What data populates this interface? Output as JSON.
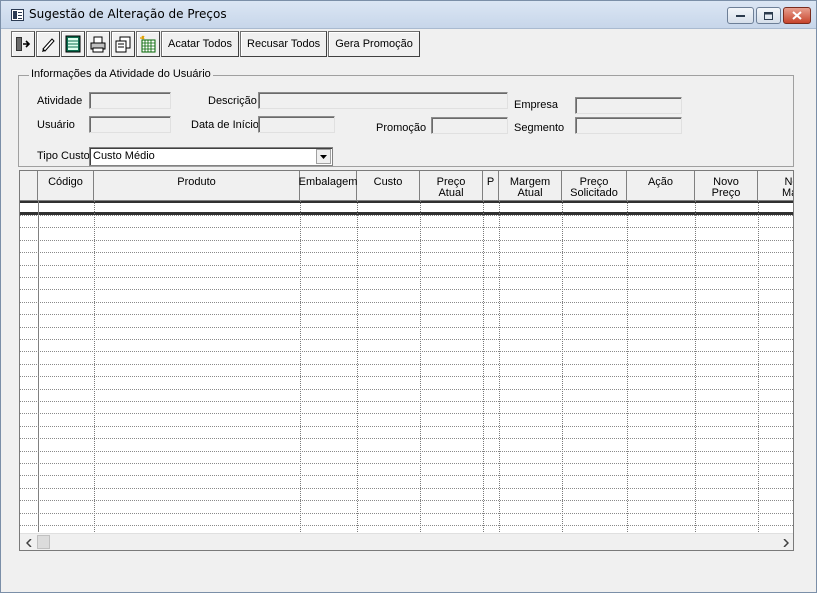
{
  "window": {
    "title": "Sugestão de Alteração de Preços"
  },
  "toolbar": {
    "icons": [
      "exit-icon",
      "edit-pencil-icon",
      "list-sheet-icon",
      "print-icon",
      "copy-pages-icon",
      "calendar-new-icon"
    ],
    "acatar_label": "Acatar Todos",
    "recusar_label": "Recusar Todos",
    "gera_label": "Gera Promoção"
  },
  "info_group": {
    "legend": "Informações da Atividade do Usuário",
    "atividade_label": "Atividade",
    "descricao_label": "Descrição",
    "empresa_label": "Empresa",
    "usuario_label": "Usuário",
    "data_inicio_label": "Data de Início",
    "promocao_label": "Promoção",
    "segmento_label": "Segmento",
    "atividade_value": "",
    "descricao_value": "",
    "empresa_value": "",
    "usuario_value": "",
    "data_inicio_value": "",
    "promocao_value": "",
    "segmento_value": ""
  },
  "tipo_custo": {
    "label": "Tipo Custo",
    "selected": "Custo Médio"
  },
  "grid": {
    "columns": [
      {
        "l1": "Código",
        "l2": ""
      },
      {
        "l1": "Produto",
        "l2": ""
      },
      {
        "l1": "Embalagem",
        "l2": ""
      },
      {
        "l1": "Custo",
        "l2": ""
      },
      {
        "l1": "Preço",
        "l2": "Atual"
      },
      {
        "l1": "P",
        "l2": ""
      },
      {
        "l1": "Margem",
        "l2": "Atual"
      },
      {
        "l1": "Preço",
        "l2": "Solicitado"
      },
      {
        "l1": "Ação",
        "l2": ""
      },
      {
        "l1": "Novo",
        "l2": "Preço"
      },
      {
        "l1": "Nov",
        "l2": "Març"
      }
    ],
    "rows": []
  }
}
